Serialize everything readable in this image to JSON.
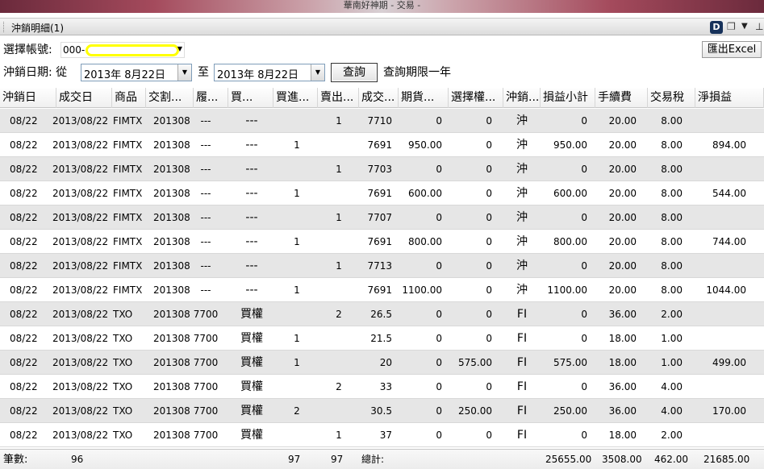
{
  "window": {
    "title": "華南好神期 - 交易 -"
  },
  "panel": {
    "title": "沖銷明細(1)"
  },
  "account": {
    "label": "選擇帳號:",
    "value": "000-"
  },
  "export": {
    "label": "匯出Excel"
  },
  "date_filter": {
    "label": "沖銷日期: 從",
    "from": "2013年  8月22日",
    "to_label": "至",
    "to": "2013年  8月22日",
    "query_label": "查詢",
    "limit_note": "查詢期限一年"
  },
  "table": {
    "columns": [
      "沖銷日",
      "成交日",
      "商品",
      "交割...",
      "履...",
      "買...",
      "買進...",
      "賣出...",
      "成交...",
      "期貨...",
      "選擇權...",
      "沖銷...",
      "損益小計",
      "手續費",
      "交易稅",
      "淨損益"
    ],
    "rows": [
      [
        "08/22",
        "2013/08/22",
        "FIMTX",
        "201308",
        "---",
        "---",
        "",
        "1",
        "7710",
        "0",
        "0",
        "沖",
        "0",
        "20.00",
        "8.00",
        ""
      ],
      [
        "08/22",
        "2013/08/22",
        "FIMTX",
        "201308",
        "---",
        "---",
        "1",
        "",
        "7691",
        "950.00",
        "0",
        "沖",
        "950.00",
        "20.00",
        "8.00",
        "894.00"
      ],
      [
        "08/22",
        "2013/08/22",
        "FIMTX",
        "201308",
        "---",
        "---",
        "",
        "1",
        "7703",
        "0",
        "0",
        "沖",
        "0",
        "20.00",
        "8.00",
        ""
      ],
      [
        "08/22",
        "2013/08/22",
        "FIMTX",
        "201308",
        "---",
        "---",
        "1",
        "",
        "7691",
        "600.00",
        "0",
        "沖",
        "600.00",
        "20.00",
        "8.00",
        "544.00"
      ],
      [
        "08/22",
        "2013/08/22",
        "FIMTX",
        "201308",
        "---",
        "---",
        "",
        "1",
        "7707",
        "0",
        "0",
        "沖",
        "0",
        "20.00",
        "8.00",
        ""
      ],
      [
        "08/22",
        "2013/08/22",
        "FIMTX",
        "201308",
        "---",
        "---",
        "1",
        "",
        "7691",
        "800.00",
        "0",
        "沖",
        "800.00",
        "20.00",
        "8.00",
        "744.00"
      ],
      [
        "08/22",
        "2013/08/22",
        "FIMTX",
        "201308",
        "---",
        "---",
        "",
        "1",
        "7713",
        "0",
        "0",
        "沖",
        "0",
        "20.00",
        "8.00",
        ""
      ],
      [
        "08/22",
        "2013/08/22",
        "FIMTX",
        "201308",
        "---",
        "---",
        "1",
        "",
        "7691",
        "1100.00",
        "0",
        "沖",
        "1100.00",
        "20.00",
        "8.00",
        "1044.00"
      ],
      [
        "08/22",
        "2013/08/22",
        "TXO",
        "201308",
        "7700",
        "買權",
        "",
        "2",
        "26.5",
        "0",
        "0",
        "FI",
        "0",
        "36.00",
        "2.00",
        ""
      ],
      [
        "08/22",
        "2013/08/22",
        "TXO",
        "201308",
        "7700",
        "買權",
        "1",
        "",
        "21.5",
        "0",
        "0",
        "FI",
        "0",
        "18.00",
        "1.00",
        ""
      ],
      [
        "08/22",
        "2013/08/22",
        "TXO",
        "201308",
        "7700",
        "買權",
        "1",
        "",
        "20",
        "0",
        "575.00",
        "FI",
        "575.00",
        "18.00",
        "1.00",
        "499.00"
      ],
      [
        "08/22",
        "2013/08/22",
        "TXO",
        "201308",
        "7700",
        "買權",
        "",
        "2",
        "33",
        "0",
        "0",
        "FI",
        "0",
        "36.00",
        "4.00",
        ""
      ],
      [
        "08/22",
        "2013/08/22",
        "TXO",
        "201308",
        "7700",
        "買權",
        "2",
        "",
        "30.5",
        "0",
        "250.00",
        "FI",
        "250.00",
        "36.00",
        "4.00",
        "170.00"
      ],
      [
        "08/22",
        "2013/08/22",
        "TXO",
        "201308",
        "7700",
        "買權",
        "",
        "1",
        "37",
        "0",
        "0",
        "FI",
        "0",
        "18.00",
        "2.00",
        ""
      ]
    ],
    "footer": {
      "count_label": "筆數:",
      "count": "96",
      "buy_total": "97",
      "sell_total": "97",
      "total_label": "總計:",
      "pnl_total": "25655.00",
      "fee_total": "3508.00",
      "tax_total": "462.00",
      "net_total": "21685.00"
    }
  },
  "colors": {
    "highlight": "#ffff00",
    "row_alt": "#e6e6e6"
  }
}
